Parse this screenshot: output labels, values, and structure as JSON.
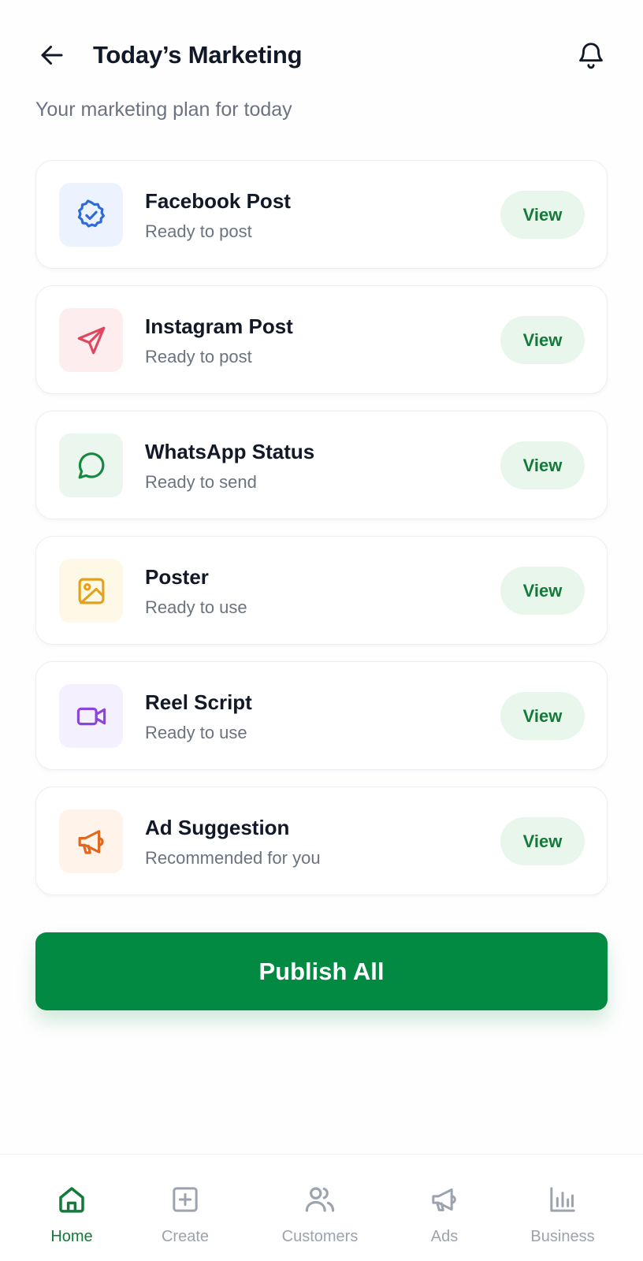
{
  "header": {
    "title": "Today’s Marketing",
    "subtitle": "Your marketing plan for today",
    "back_icon": "arrow-left-icon",
    "notification_icon": "bell-icon"
  },
  "cards": [
    {
      "title": "Facebook Post",
      "status": "Ready to post",
      "action": "View",
      "icon": "verified-badge-icon",
      "icon_color": "#2f6bd8",
      "icon_bg": "#ecf3fe"
    },
    {
      "title": "Instagram Post",
      "status": "Ready to post",
      "action": "View",
      "icon": "send-icon",
      "icon_color": "#e0475f",
      "icon_bg": "#fdedef"
    },
    {
      "title": "WhatsApp Status",
      "status": "Ready to send",
      "action": "View",
      "icon": "message-circle-icon",
      "icon_color": "#16883f",
      "icon_bg": "#ebf7ee"
    },
    {
      "title": "Poster",
      "status": "Ready to use",
      "action": "View",
      "icon": "image-icon",
      "icon_color": "#e4a21c",
      "icon_bg": "#fef9e7"
    },
    {
      "title": "Reel Script",
      "status": "Ready to use",
      "action": "View",
      "icon": "video-icon",
      "icon_color": "#8b45d9",
      "icon_bg": "#f4f0fe"
    },
    {
      "title": "Ad Suggestion",
      "status": "Recommended for you",
      "action": "View",
      "icon": "megaphone-icon",
      "icon_color": "#e0671f",
      "icon_bg": "#fff3ea"
    }
  ],
  "publish": {
    "label": "Publish All"
  },
  "nav": {
    "items": [
      {
        "label": "Home",
        "icon": "home-icon",
        "active": true
      },
      {
        "label": "Create",
        "icon": "plus-square-icon",
        "active": false
      },
      {
        "label": "Customers",
        "icon": "users-icon",
        "active": false
      },
      {
        "label": "Ads",
        "icon": "megaphone-icon",
        "active": false
      },
      {
        "label": "Business",
        "icon": "bar-chart-icon",
        "active": false
      }
    ]
  },
  "colors": {
    "accent": "#028a42",
    "accent_text": "#137a3a",
    "view_button_bg": "#e9f6ec",
    "muted_text": "#6b7280",
    "inactive_nav": "#9ca3af"
  }
}
